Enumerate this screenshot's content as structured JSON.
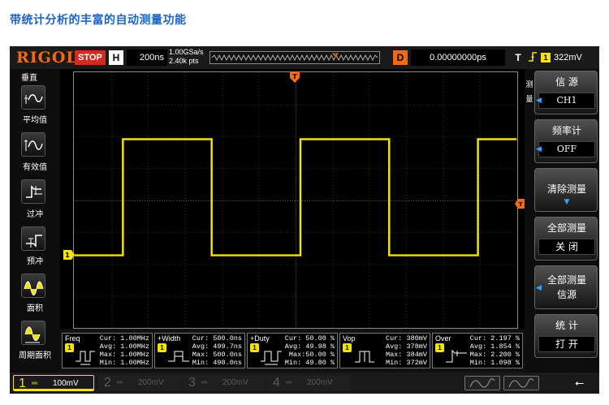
{
  "page": {
    "title": "带统计分析的丰富的自动测量功能"
  },
  "topbar": {
    "logo": "RIGOL",
    "run_state": "STOP",
    "horizontal_label": "H",
    "timebase": "200ns",
    "sample_rate": "1.00GSa/s",
    "memory_depth": "2.40k pts",
    "delay_label": "D",
    "horizontal_position": "0.00000000ps",
    "trigger_label": "T",
    "trigger_source": "1",
    "trigger_level": "322mV"
  },
  "left_menu": {
    "heading": "垂直",
    "items": [
      {
        "label": "平均值",
        "icon": "average-icon"
      },
      {
        "label": "有效值",
        "icon": "rms-icon"
      },
      {
        "label": "过冲",
        "icon": "overshoot-icon"
      },
      {
        "label": "预冲",
        "icon": "preshoot-icon"
      },
      {
        "label": "面积",
        "icon": "area-icon"
      },
      {
        "label": "周期面积",
        "icon": "period-area-icon"
      }
    ]
  },
  "right_menu": {
    "side_label": [
      "测",
      "量"
    ],
    "items": [
      {
        "title": "信 源",
        "value": "CH1"
      },
      {
        "title": "频率计",
        "value": "OFF"
      },
      {
        "title": "清除测量"
      },
      {
        "title": "全部测量",
        "value": "关 闭"
      },
      {
        "title": "全部测量",
        "subtitle": "信源"
      },
      {
        "title": "统 计",
        "value": "打 开"
      }
    ]
  },
  "measurements": [
    {
      "name": "Freq",
      "cur": "Cur: 1.00MHz",
      "avg": "Avg: 1.00MHz",
      "max": "Max: 1.00MHz",
      "min": "Min: 1.00MHz"
    },
    {
      "name": "+Width",
      "cur": "Cur: 500.0ns",
      "avg": "Avg: 499.7ns",
      "max": "Max: 500.0ns",
      "min": "Min: 498.0ns"
    },
    {
      "name": "+Duty",
      "cur": "Cur: 50.00 %",
      "avg": "Avg: 49.98 %",
      "max": "Max:50.00 %",
      "min": "Min: 49.80 %"
    },
    {
      "name": "Vop",
      "cur": "Cur: 380mV",
      "avg": "Avg: 378mV",
      "max": "Max: 384mV",
      "min": "Min: 372mV"
    },
    {
      "name": "Over",
      "cur": "Cur: 2.197 %",
      "avg": "Avg: 1.854 %",
      "max": "Max: 2.200 %",
      "min": "Min: 1.098 %"
    }
  ],
  "channels": [
    {
      "number": "1",
      "coupling": "═",
      "scale": "100mV",
      "active": true,
      "color": "#f2e30f"
    },
    {
      "number": "2",
      "coupling": "═",
      "scale": "200mV",
      "active": false,
      "color": "#5a5a5a"
    },
    {
      "number": "3",
      "coupling": "═",
      "scale": "200mV",
      "active": false,
      "color": "#5a5a5a"
    },
    {
      "number": "4",
      "coupling": "═",
      "scale": "200mV",
      "active": false,
      "color": "#5a5a5a"
    }
  ],
  "colors": {
    "ch1": "#f2e30f",
    "accent_orange": "#f26a12",
    "stop_red": "#d42a1f",
    "title_blue": "#1c63c6"
  }
}
